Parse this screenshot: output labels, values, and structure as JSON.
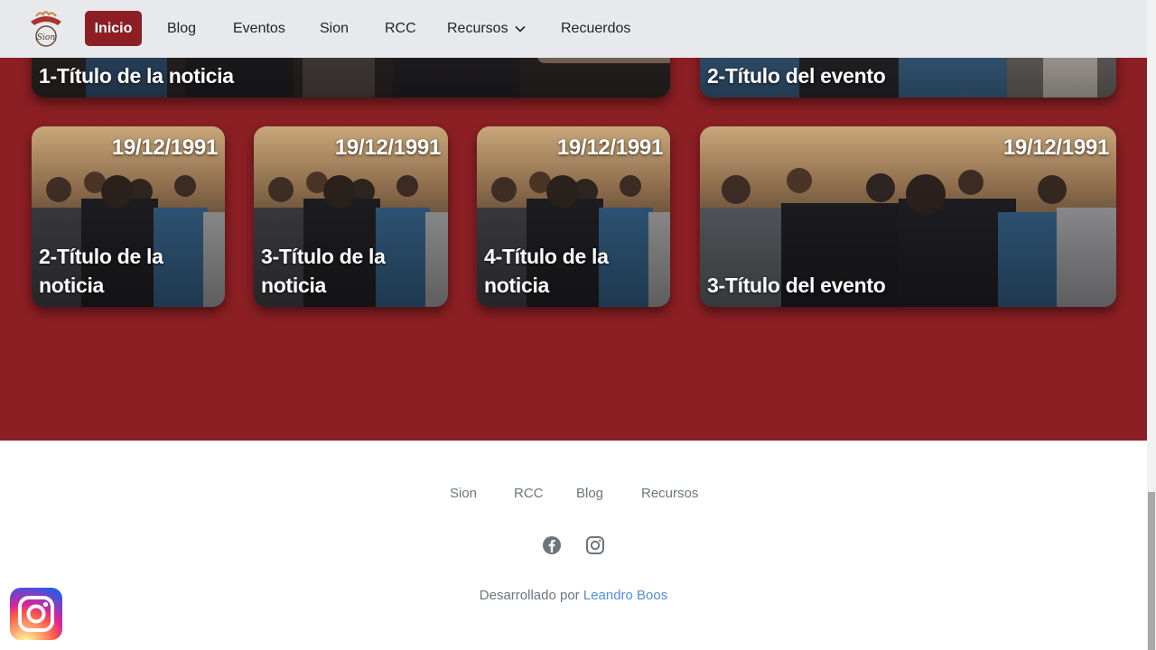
{
  "navbar": {
    "logo_alt": "Sion",
    "items": [
      {
        "label": "Inicio",
        "active": true
      },
      {
        "label": "Blog"
      },
      {
        "label": "Eventos"
      },
      {
        "label": "Sion"
      },
      {
        "label": "RCC"
      },
      {
        "label": "Recursos",
        "has_dropdown": true
      },
      {
        "label": "Recuerdos"
      }
    ]
  },
  "top_cards": [
    {
      "title": "1-Título de la noticia"
    },
    {
      "title": "2-Título del evento"
    }
  ],
  "cards": [
    {
      "date": "19/12/1991",
      "title": "2-Título de la noticia"
    },
    {
      "date": "19/12/1991",
      "title": "3-Título de la noticia"
    },
    {
      "date": "19/12/1991",
      "title": "4-Título de la noticia"
    },
    {
      "date": "19/12/1991",
      "title": "3-Título del evento"
    }
  ],
  "footer": {
    "links": [
      "Sion",
      "RCC",
      "Blog",
      "Recursos"
    ],
    "social": [
      "facebook-icon",
      "instagram-icon"
    ],
    "credit_prefix": "Desarrollado por ",
    "credit_author": "Leandro Boos"
  },
  "floating_button": "instagram-icon",
  "colors": {
    "brand": "#8b1f24",
    "navbar_bg": "#e8e9ed",
    "footer_text": "#6c757d",
    "link": "#4f8fd6"
  }
}
